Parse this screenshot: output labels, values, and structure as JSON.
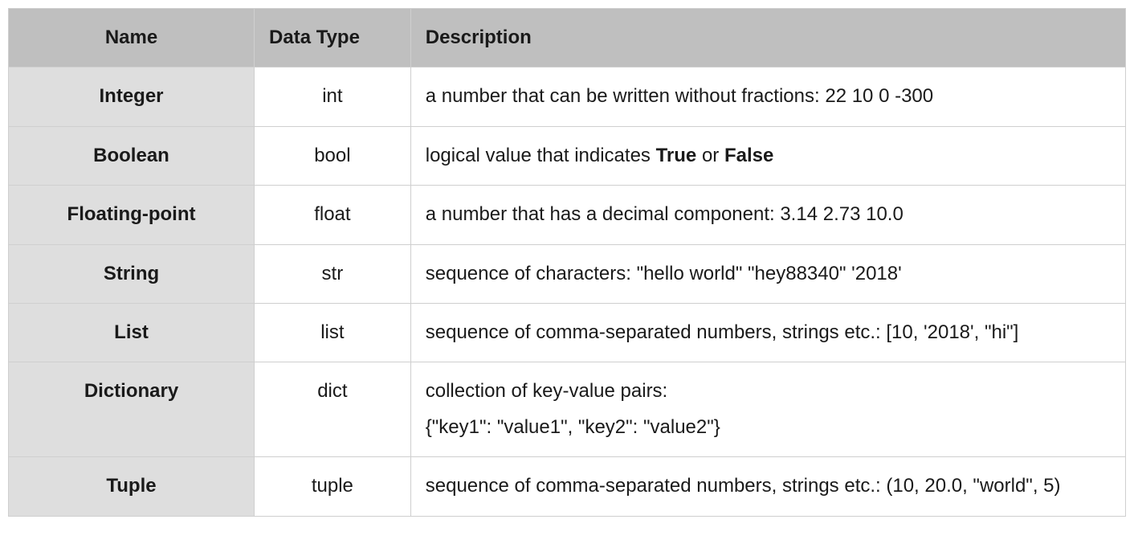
{
  "headers": {
    "name": "Name",
    "dataType": "Data Type",
    "description": "Description"
  },
  "rows": [
    {
      "name": "Integer",
      "dataType": "int",
      "description": "a number that can be written without fractions: 22  10  0  -300"
    },
    {
      "name": "Boolean",
      "dataType": "bool",
      "description": "logical value that indicates <b>True</b> or <b>False</b>"
    },
    {
      "name": "Floating-point",
      "dataType": "float",
      "description": "a number that has a decimal component: 3.14   2.73   10.0"
    },
    {
      "name": "String",
      "dataType": "str",
      "description": "sequence of characters: \"hello world\"   \"hey88340\"   '2018'"
    },
    {
      "name": "List",
      "dataType": "list",
      "description": "sequence of comma-separated numbers, strings etc.: [10, '2018', \"hi\"]"
    },
    {
      "name": "Dictionary",
      "dataType": "dict",
      "description": "collection of key-value pairs:<br>{\"key1\": \"value1\", \"key2\": \"value2\"}"
    },
    {
      "name": "Tuple",
      "dataType": "tuple",
      "description": "sequence of comma-separated numbers, strings etc.: (10, 20.0, \"world\", 5)"
    }
  ]
}
